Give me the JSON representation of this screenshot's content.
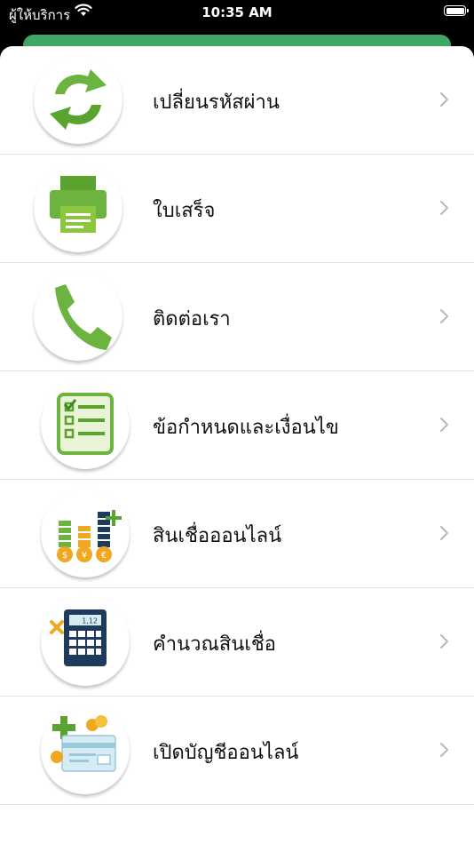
{
  "status_bar": {
    "carrier": "ผู้ให้บริการ",
    "time": "10:35 AM"
  },
  "colors": {
    "header_green": "#3fa664",
    "icon_green": "#6db33f",
    "icon_navy": "#1f3b5c",
    "coin_gold": "#f0a820"
  },
  "menu": {
    "items": [
      {
        "label": "เปลี่ยนรหัสผ่าน",
        "icon": "refresh-arrows-icon"
      },
      {
        "label": "ใบเสร็จ",
        "icon": "printer-icon"
      },
      {
        "label": "ติดต่อเรา",
        "icon": "phone-icon"
      },
      {
        "label": "ข้อกำหนดและเงื่อนไข",
        "icon": "checklist-icon"
      },
      {
        "label": "สินเชื่อออนไลน์",
        "icon": "coin-stacks-icon"
      },
      {
        "label": "คำนวณสินเชื่อ",
        "icon": "calculator-icon"
      },
      {
        "label": "เปิดบัญชีออนไลน์",
        "icon": "add-account-card-icon"
      }
    ]
  },
  "calculator_display": "1,12"
}
